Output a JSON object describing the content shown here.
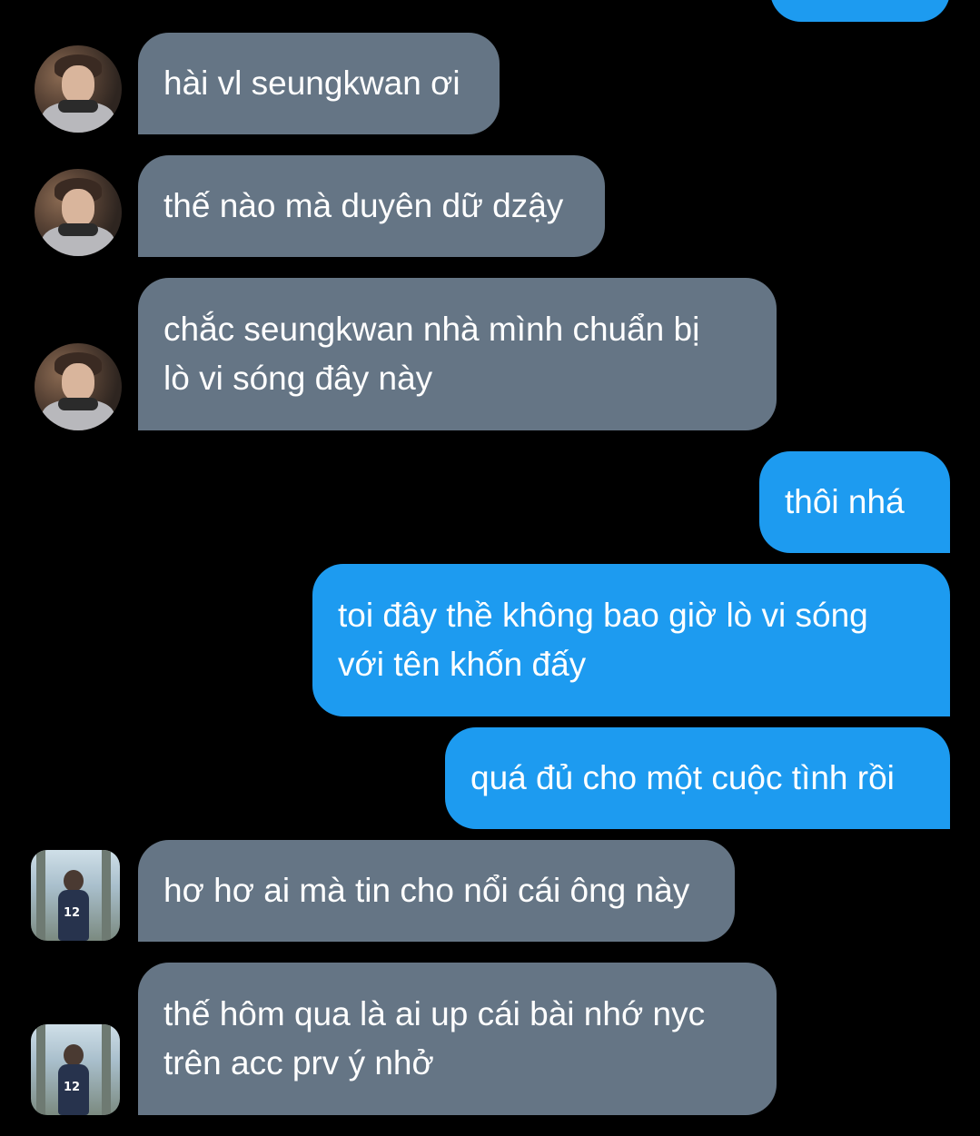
{
  "colors": {
    "background": "#000000",
    "incoming_bubble": "#657585",
    "outgoing_bubble": "#1d9bf0",
    "text": "#ffffff"
  },
  "messages": [
    {
      "direction": "outgoing",
      "text": ""
    },
    {
      "direction": "incoming",
      "sender": "avatar-1",
      "text": "hài vl seungkwan ơi"
    },
    {
      "direction": "incoming",
      "sender": "avatar-1",
      "text": "thế nào mà duyên dữ dzậy"
    },
    {
      "direction": "incoming",
      "sender": "avatar-1",
      "text": "chắc seungkwan nhà mình chuẩn bị\nlò vi sóng đây này"
    },
    {
      "direction": "outgoing",
      "text": "thôi nhá"
    },
    {
      "direction": "outgoing",
      "text": "toi đây thề không bao giờ lò vi sóng\nvới tên khốn đấy"
    },
    {
      "direction": "outgoing",
      "text": "quá đủ cho một cuộc tình rồi"
    },
    {
      "direction": "incoming",
      "sender": "avatar-2",
      "text": "hơ hơ ai mà tin cho nổi cái ông này"
    },
    {
      "direction": "incoming",
      "sender": "avatar-2",
      "text": "thế hôm qua là ai up cái bài nhớ nyc\ntrên acc prv ý nhở"
    }
  ]
}
